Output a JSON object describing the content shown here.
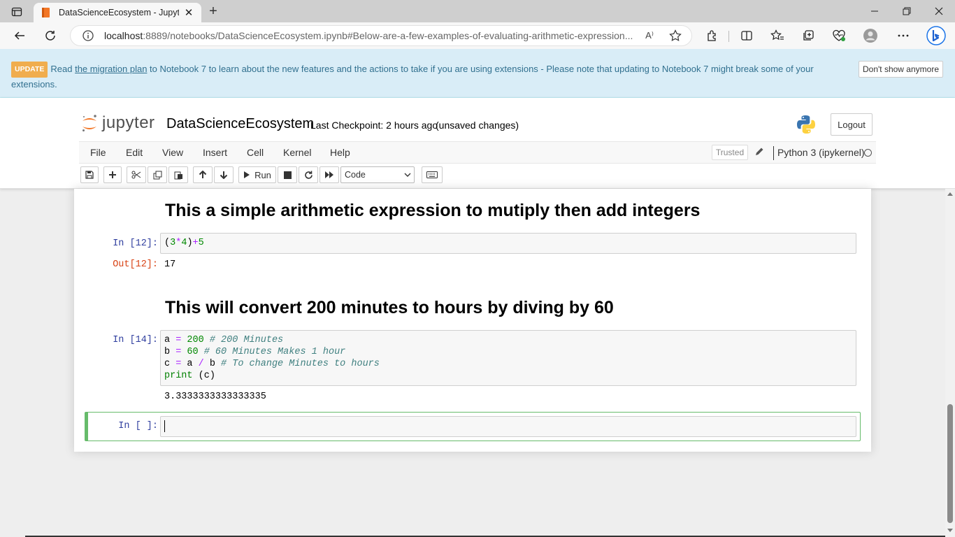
{
  "browser": {
    "tab_title": "DataScienceEcosystem - Jupyter",
    "tab_close": "✕",
    "new_tab": "+",
    "url_host": "localhost",
    "url_rest": ":8889/notebooks/DataScienceEcosystem.ipynb#Below-are-a-few-examples-of-evaluating-arithmetic-expression...",
    "read_aloud": "A⁾"
  },
  "banner": {
    "badge": "UPDATE",
    "text_before_link": "Read ",
    "link_text": "the migration plan",
    "text_after_link": " to Notebook 7 to learn about the new features and the actions to take if you are using extensions - Please note that updating to Notebook 7 might break some of your extensions.",
    "dismiss_label": "Don't show anymore"
  },
  "header": {
    "logo_text": "jupyter",
    "notebook_name": "DataScienceEcosystem",
    "checkpoint": "Last Checkpoint: 2 hours ago",
    "autosave": "(unsaved changes)",
    "logout_label": "Logout"
  },
  "menu": {
    "items": [
      "File",
      "Edit",
      "View",
      "Insert",
      "Cell",
      "Kernel",
      "Help"
    ],
    "trusted": "Trusted",
    "kernel_name": "Python 3 (ipykernel)"
  },
  "toolbar": {
    "run_label": "Run",
    "cell_type": "Code"
  },
  "cells": {
    "md1": "This a simple arithmetic expression to mutiply then add integers",
    "c1_prompt": "In [12]:",
    "c1_out_prompt": "Out[12]:",
    "c1_output": "17",
    "md2": "This will convert 200 minutes to hours by diving by 60",
    "c2_prompt": "In [14]:",
    "c2_output": "3.3333333333333335",
    "c3_prompt": "In [ ]:"
  },
  "code": {
    "c1": {
      "open_paren": "(",
      "n1": "3",
      "op1": "*",
      "n2": "4",
      "close_paren": ")",
      "op2": "+",
      "n3": "5"
    },
    "c2": {
      "l1_var": "a ",
      "l1_eq": "=",
      "l1_num": "200",
      "l1_cm": "# 200 Minutes",
      "l2_var": "b ",
      "l2_eq": "=",
      "l2_num": "60",
      "l2_cm": "# 60 Minutes Makes 1 hour",
      "l3_var": "c ",
      "l3_eq": "=",
      "l3_a": " a ",
      "l3_div": "/",
      "l3_b": " b ",
      "l3_cm": "# To change Minutes to hours",
      "l4_fn": "print",
      "l4_args": " (c)"
    }
  },
  "colors": {
    "banner_bg": "#d9edf7",
    "prompt_in": "#303f9f",
    "prompt_out": "#d84315",
    "selected_cell": "#66bb6a"
  }
}
